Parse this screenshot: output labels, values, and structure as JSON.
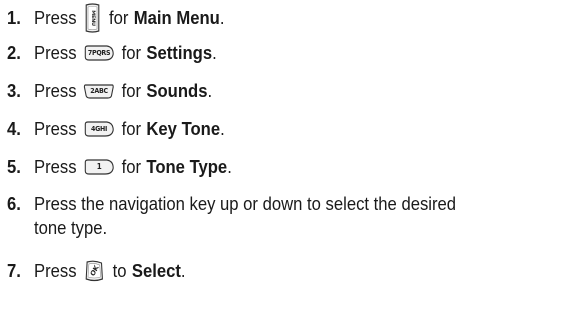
{
  "steps": [
    {
      "num": "1.",
      "pre": "Press",
      "key": "menu-key",
      "key_label": "MENU",
      "mid": "for",
      "bold": "Main Menu",
      "post": "."
    },
    {
      "num": "2.",
      "pre": "Press",
      "key": "7-pqrs-key",
      "key_label": "7PQRS",
      "mid": "for",
      "bold": "Settings",
      "post": "."
    },
    {
      "num": "3.",
      "pre": "Press",
      "key": "2-abc-key",
      "key_label": "2ABC",
      "mid": "for",
      "bold": "Sounds",
      "post": "."
    },
    {
      "num": "4.",
      "pre": "Press",
      "key": "4-ghi-key",
      "key_label": "4GHI",
      "mid": "for",
      "bold": "Key Tone",
      "post": "."
    },
    {
      "num": "5.",
      "pre": "Press",
      "key": "1-key",
      "key_label": "1",
      "mid": "for",
      "bold": "Tone Type",
      "post": "."
    },
    {
      "num": "6.",
      "line1": "Press the navigation key up or down to select the desired",
      "line2": "tone type."
    },
    {
      "num": "7.",
      "pre": "Press",
      "key": "ok-key",
      "key_label": "OK",
      "mid": "to",
      "bold": "Select",
      "post": "."
    }
  ]
}
